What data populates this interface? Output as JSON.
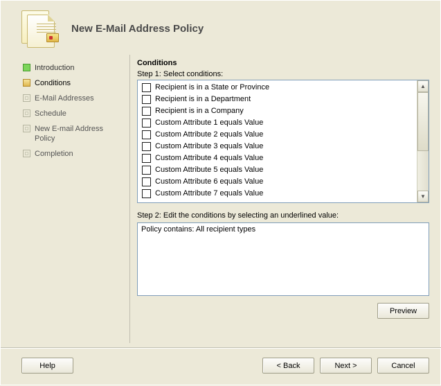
{
  "title": "New E-Mail Address Policy",
  "nav": {
    "items": [
      {
        "label": "Introduction",
        "state": "done"
      },
      {
        "label": "Conditions",
        "state": "current"
      },
      {
        "label": "E-Mail Addresses",
        "state": "pending"
      },
      {
        "label": "Schedule",
        "state": "pending"
      },
      {
        "label": "New E-mail Address Policy",
        "state": "pending"
      },
      {
        "label": "Completion",
        "state": "pending"
      }
    ]
  },
  "main": {
    "section_title": "Conditions",
    "step1_label": "Step 1: Select conditions:",
    "conditions": [
      {
        "checked": false,
        "label": "Recipient is in a State or Province"
      },
      {
        "checked": false,
        "label": "Recipient is in a Department"
      },
      {
        "checked": false,
        "label": "Recipient is in a Company"
      },
      {
        "checked": false,
        "label": "Custom Attribute 1 equals Value"
      },
      {
        "checked": false,
        "label": "Custom Attribute 2 equals Value"
      },
      {
        "checked": false,
        "label": "Custom Attribute 3 equals Value"
      },
      {
        "checked": false,
        "label": "Custom Attribute 4 equals Value"
      },
      {
        "checked": false,
        "label": "Custom Attribute 5 equals Value"
      },
      {
        "checked": false,
        "label": "Custom Attribute 6 equals Value"
      },
      {
        "checked": false,
        "label": "Custom Attribute 7 equals Value"
      }
    ],
    "step2_label": "Step 2: Edit the conditions by selecting an underlined value:",
    "policy_text": "Policy contains: All recipient types",
    "preview_label": "Preview"
  },
  "footer": {
    "help": "Help",
    "back": "< Back",
    "next": "Next >",
    "cancel": "Cancel"
  }
}
